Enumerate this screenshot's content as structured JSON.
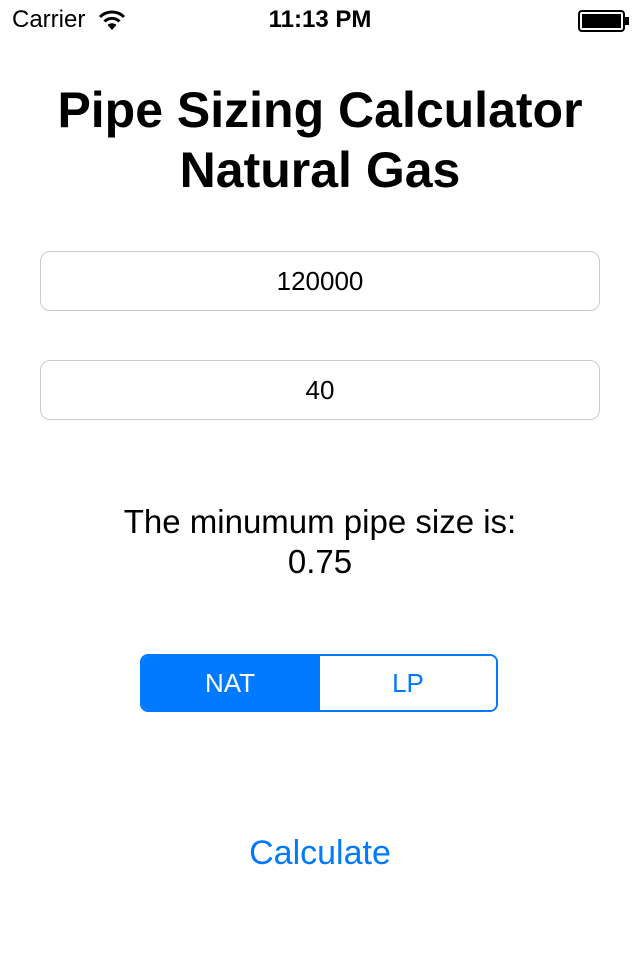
{
  "status_bar": {
    "carrier": "Carrier",
    "time": "11:13 PM",
    "wifi_icon": "wifi-icon",
    "battery_icon": "battery-icon"
  },
  "header": {
    "title_line1": "Pipe Sizing Calculator",
    "title_line2": "Natural Gas"
  },
  "inputs": {
    "btu_value": "120000",
    "length_value": "40"
  },
  "result": {
    "label": "The minumum pipe size is:",
    "value": "0.75"
  },
  "gas_type": {
    "options": [
      "NAT",
      "LP"
    ],
    "selected": "NAT"
  },
  "actions": {
    "calculate_label": "Calculate"
  },
  "colors": {
    "accent": "#007aff",
    "field_border": "#cccccc",
    "background": "#ffffff"
  }
}
